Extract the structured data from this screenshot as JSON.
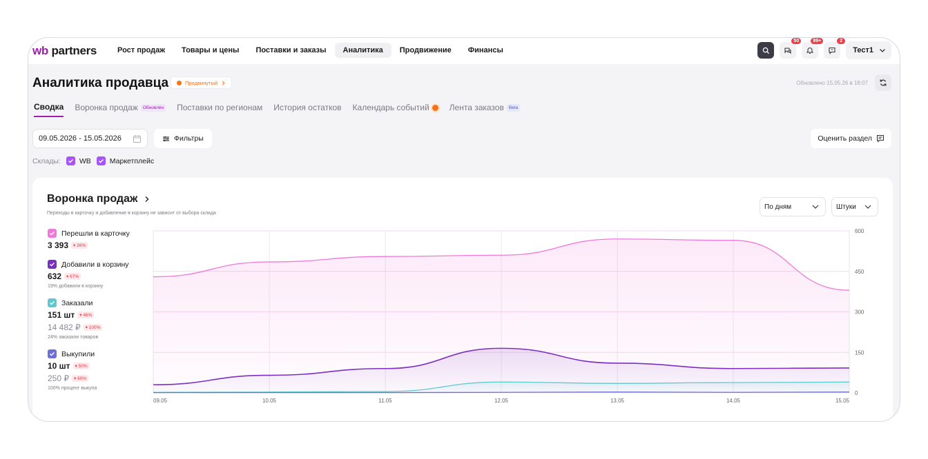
{
  "nav": {
    "logo_wb": "wb",
    "logo_partners": "partners",
    "items": [
      "Рост продаж",
      "Товары и цены",
      "Поставки и заказы",
      "Аналитика",
      "Продвижение",
      "Финансы"
    ],
    "active": "Аналитика",
    "badges": {
      "chat": "50",
      "bell": "99+",
      "support": "2"
    },
    "user": "Тест1"
  },
  "header": {
    "title": "Аналитика продавца",
    "level_badge": "Продвинутый",
    "updated": "Обновлено 15.05.26 в 18:07"
  },
  "tabs": [
    {
      "label": "Сводка",
      "active": true
    },
    {
      "label": "Воронка продаж",
      "tag": "Обновлён"
    },
    {
      "label": "Поставки по регионам"
    },
    {
      "label": "История остатков"
    },
    {
      "label": "Календарь событий"
    },
    {
      "label": "Лента заказов",
      "tag": "Beta"
    }
  ],
  "filters": {
    "date_range": "09.05.2026 - 15.05.2026",
    "filters_label": "Фильтры",
    "rate_label": "Оценить раздел",
    "stores_label": "Склады:",
    "stores": [
      "WB",
      "Маркетплейс"
    ]
  },
  "card": {
    "title": "Воронка продаж",
    "subtitle": "Переходы в карточку и добавление в корзину не зависит от выбора склада",
    "period_select": "По дням",
    "unit_select": "Штуки"
  },
  "legend": [
    {
      "label": "Перешли в карточку",
      "value": "3 393",
      "change": "26%",
      "color": "#f078d8"
    },
    {
      "label": "Добавили в корзину",
      "value": "632",
      "change": "67%",
      "note": "19% добавили в корзину",
      "color": "#7b2fbe"
    },
    {
      "label": "Заказали",
      "value": "151 шт",
      "change": "46%",
      "value2": "14 482 ₽",
      "change2": "100%",
      "note": "24% заказали товаров",
      "color": "#5fc9d0"
    },
    {
      "label": "Выкупили",
      "value": "10 шт",
      "change": "50%",
      "value2": "250 ₽",
      "change2": "60%",
      "note": "100% процент выкупа",
      "color": "#6b6fd8"
    }
  ],
  "chart_data": {
    "type": "area",
    "x": [
      "09.05",
      "10.05",
      "11.05",
      "12.05",
      "13.05",
      "14.05",
      "15.05"
    ],
    "yticks": [
      0,
      150,
      300,
      450,
      600
    ],
    "ylim": [
      0,
      600
    ],
    "series": [
      {
        "name": "Перешли в карточку",
        "color": "#f078d8",
        "values": [
          430,
          485,
          505,
          510,
          570,
          565,
          380
        ]
      },
      {
        "name": "Добавили в корзину",
        "color": "#7b2fbe",
        "values": [
          30,
          65,
          90,
          165,
          110,
          90,
          92
        ]
      },
      {
        "name": "Заказали",
        "color": "#5fc9d0",
        "values": [
          2,
          3,
          5,
          40,
          35,
          38,
          40
        ]
      },
      {
        "name": "Выкупили",
        "color": "#6b6fd8",
        "values": [
          1,
          1,
          1,
          2,
          3,
          2,
          3
        ]
      }
    ]
  }
}
